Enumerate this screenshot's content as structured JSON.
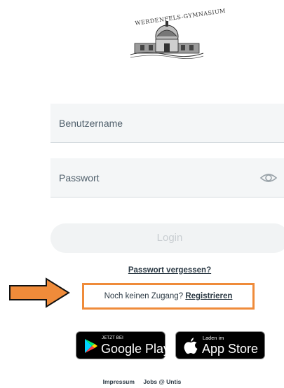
{
  "logo": {
    "text": "WERDENFELS-GYMNASIUM"
  },
  "form": {
    "username_placeholder": "Benutzername",
    "password_placeholder": "Passwort",
    "login_label": "Login",
    "forgot_label": "Passwort vergessen?"
  },
  "register": {
    "prompt": "Noch keinen Zugang?",
    "link_label": "Registrieren"
  },
  "stores": {
    "google": {
      "small": "JETZT BEI",
      "big": "Google Play"
    },
    "apple": {
      "small": "Laden im",
      "big": "App Store"
    }
  },
  "footer": {
    "impressum": "Impressum",
    "jobs": "Jobs @ Untis"
  },
  "colors": {
    "highlight": "#ef8b3a",
    "field_bg": "#f4f6f7",
    "button_bg": "#f1f3f4"
  }
}
